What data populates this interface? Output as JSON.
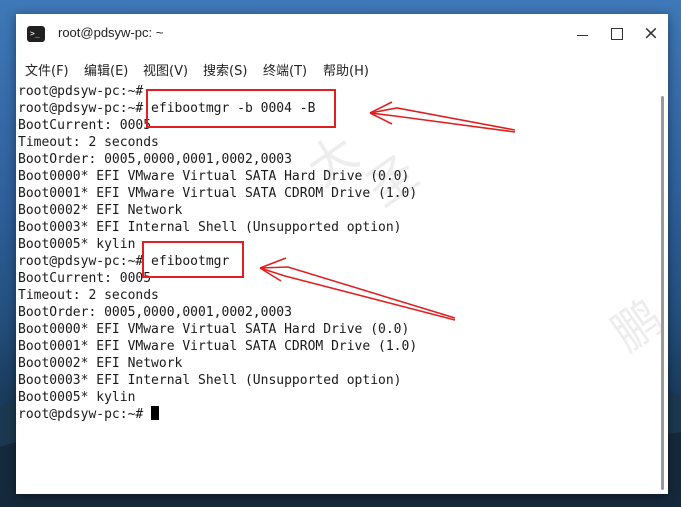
{
  "window": {
    "title": "root@pdsyw-pc: ~",
    "app_icon_glyph": ">_",
    "close_glyph": "×"
  },
  "menubar": {
    "items": [
      "文件(F)",
      "编辑(E)",
      "视图(V)",
      "搜索(S)",
      "终端(T)",
      "帮助(H)"
    ]
  },
  "terminal": {
    "lines": [
      "root@pdsyw-pc:~#",
      "root@pdsyw-pc:~# efibootmgr -b 0004 -B",
      "BootCurrent: 0005",
      "Timeout: 2 seconds",
      "BootOrder: 0005,0000,0001,0002,0003",
      "Boot0000* EFI VMware Virtual SATA Hard Drive (0.0)",
      "Boot0001* EFI VMware Virtual SATA CDROM Drive (1.0)",
      "Boot0002* EFI Network",
      "Boot0003* EFI Internal Shell (Unsupported option)",
      "Boot0005* kylin",
      "root@pdsyw-pc:~# efibootmgr",
      "BootCurrent: 0005",
      "Timeout: 2 seconds",
      "BootOrder: 0005,0000,0001,0002,0003",
      "Boot0000* EFI VMware Virtual SATA Hard Drive (0.0)",
      "Boot0001* EFI VMware Virtual SATA CDROM Drive (1.0)",
      "Boot0002* EFI Network",
      "Boot0003* EFI Internal Shell (Unsupported option)",
      "Boot0005* kylin",
      "root@pdsyw-pc:~# "
    ]
  },
  "watermarks": [
    "大",
    "圣",
    "鹏"
  ],
  "colors": {
    "annotation": "#e02020",
    "terminal_bg": "#ffffff",
    "terminal_fg": "#1a1a1a"
  },
  "icons": {
    "app": "terminal-icon",
    "minimize": "minimize-icon",
    "maximize": "maximize-icon",
    "close": "close-icon"
  }
}
